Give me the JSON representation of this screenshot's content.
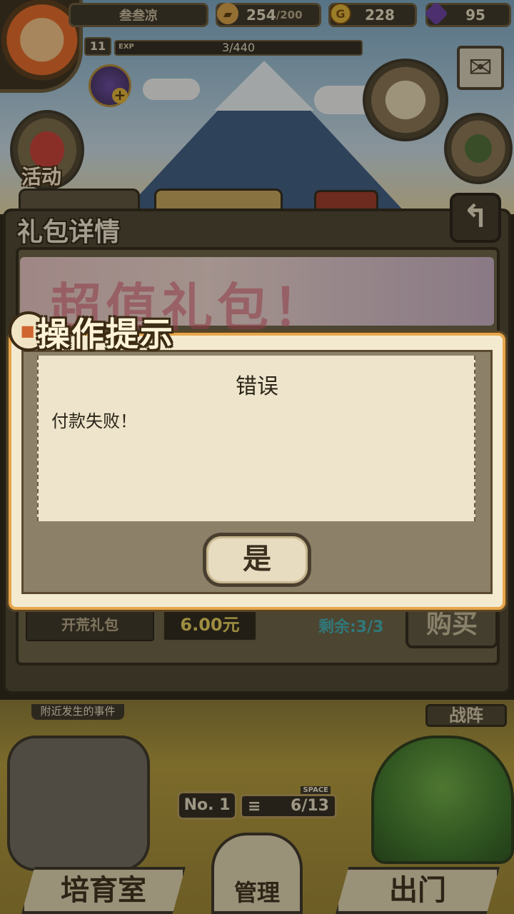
{
  "hud": {
    "player_name": "叁叁凉",
    "food": "254",
    "food_max": "/200",
    "gold": "228",
    "gems": "95",
    "level": "11",
    "exp_label": "EXP",
    "exp": "3/440"
  },
  "side_buttons": {
    "event_label": "活动"
  },
  "panel": {
    "title": "礼包详情",
    "banner_text": "超值礼包！",
    "pack_name": "开荒礼包",
    "price": "6.00元",
    "remaining": "剩余:3/3",
    "buy_label": "购买",
    "back_icon": "↰"
  },
  "dialog": {
    "header": "操作提示",
    "title": "错误",
    "message": "付款失败！",
    "confirm_label": "是"
  },
  "bottom": {
    "news_label": "附近发生的事件",
    "battle_label": "战阵",
    "rank": "No. 1",
    "space_label": "SPACE",
    "space_value": "6/13",
    "nav_nursery": "培育室",
    "nav_manage": "管理",
    "nav_go": "出门"
  },
  "colors": {
    "gold_accent": "#e3b53a",
    "dialog_border": "#e7a64a",
    "remaining_text": "#3fb0b7",
    "price_text": "#e6cf5e"
  }
}
